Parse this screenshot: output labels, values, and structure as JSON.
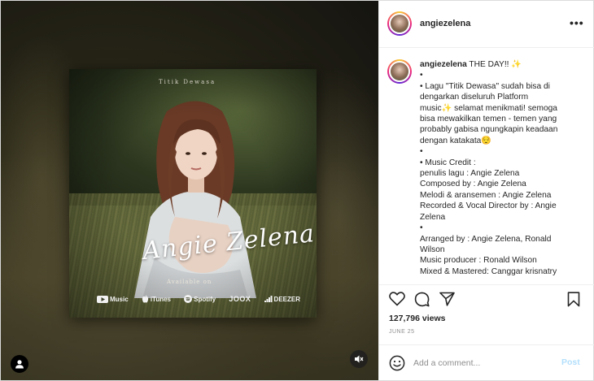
{
  "post": {
    "username": "angiezelena",
    "more_label": "•••",
    "caption_lines": [
      "•",
      "• Lagu \"Titik Dewasa\" sudah bisa di",
      "dengarkan diseluruh Platform",
      "music✨ selamat menikmati! semoga",
      "bisa mewakilkan temen - temen yang",
      "probably gabisa ngungkapin keadaan",
      "dengan katakata😌",
      "•",
      "• Music Credit :",
      "penulis lagu : Angie Zelena",
      "Composed by : Angie Zelena",
      "Melodi & aransemen : Angie Zelena",
      "Recorded & Vocal Director by : Angie",
      "Zelena",
      "•",
      "Arranged by : Angie Zelena, Ronald",
      "Wilson",
      "Music producer : Ronald Wilson",
      "Mixed & Mastered: Canggar krisnatry"
    ],
    "caption_first": "THE DAY!! ✨",
    "views": "127,796 views",
    "date": "JUNE 25"
  },
  "cover": {
    "title": "Titik Dewasa",
    "artist": "Angie Zelena",
    "available": "Available on",
    "platforms": [
      "Music",
      "iTunes",
      "Spotify",
      "JOOX",
      "DEEZER"
    ]
  },
  "comment": {
    "placeholder": "Add a comment...",
    "post_label": "Post"
  },
  "icons": {
    "like": "heart-icon",
    "comment": "comment-icon",
    "share": "paper-plane-icon",
    "save": "bookmark-icon",
    "emoji": "smiley-icon",
    "user_tag": "person-icon",
    "mute": "speaker-muted-icon"
  },
  "colors": {
    "post_button": "#b2dffc",
    "muted_text": "#8e8e8e",
    "border": "#efefef"
  }
}
